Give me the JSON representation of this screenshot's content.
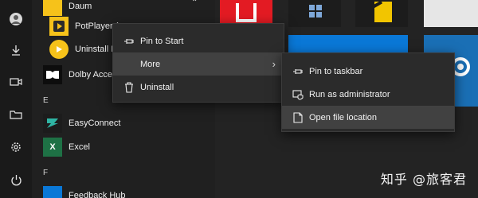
{
  "sidebar": {
    "icons": [
      "avatar",
      "document-icon",
      "download-icon",
      "video-icon",
      "folder-icon",
      "gear-icon",
      "power-icon"
    ]
  },
  "app_list": {
    "group_daum": "Daum",
    "apps_daum": [
      "PotPlayer (",
      "Uninstall P"
    ],
    "dolby": "Dolby Acces",
    "letter_e": "E",
    "easyconnect": "EasyConnect",
    "excel": "Excel",
    "letter_f": "F",
    "feedback": "Feedback Hub"
  },
  "context_menu": {
    "items": [
      {
        "label": "Pin to Start",
        "icon": "pin-icon"
      },
      {
        "label": "More",
        "icon": "none"
      },
      {
        "label": "Uninstall",
        "icon": "trash-icon"
      }
    ],
    "more_arrow": "›"
  },
  "submenu": {
    "items": [
      {
        "label": "Pin to taskbar",
        "icon": "pin-icon"
      },
      {
        "label": "Run as administrator",
        "icon": "shield-icon"
      },
      {
        "label": "Open file location",
        "icon": "file-icon"
      }
    ]
  },
  "watermark": "知乎 @旅客君",
  "colors": {
    "tile_red": "#e31b23",
    "tile_blue": "#0a78d7",
    "tile_yellow": "#f2c500",
    "steam_blue": "#1a6fb5",
    "potplayer_yellow": "#f6c21a"
  }
}
